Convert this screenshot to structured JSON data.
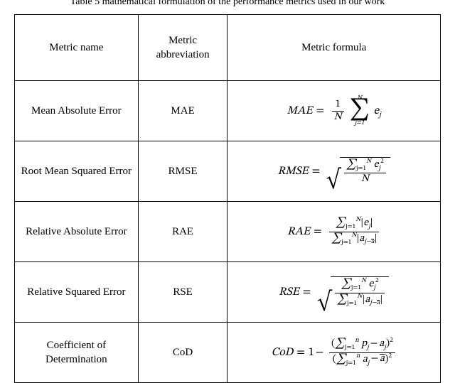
{
  "caption": "Table 5 mathematical formulation of the performance metrics used in our work",
  "headers": {
    "name": "Metric name",
    "abbr": "Metric abbreviation",
    "formula": "Metric formula"
  },
  "metrics": [
    {
      "name": "Mean Absolute Error",
      "abbr": "MAE",
      "formula_id": "mae",
      "formula_tex": "MAE = \\frac{1}{N} \\sum_{j=1}^{N} e_j"
    },
    {
      "name": "Root Mean Squared Error",
      "abbr": "RMSE",
      "formula_id": "rmse",
      "formula_tex": "RMSE = \\sqrt{ \\frac{\\sum_{j=1}^{N} e_j^{2}}{N} }"
    },
    {
      "name": "Relative Absolute Error",
      "abbr": "RAE",
      "formula_id": "rae",
      "formula_tex": "RAE = \\frac{\\sum_{j=1}^{N} |e_j|}{\\sum_{j=1}^{N} |a_{j} - \\bar a|}"
    },
    {
      "name": "Relative Squared Error",
      "abbr": "RSE",
      "formula_id": "rse",
      "formula_tex": "RSE = \\sqrt{ \\frac{\\sum_{j=1}^{N} e_j^{2}}{\\sum_{j=1}^{N} |a_{j} - \\bar a|} }"
    },
    {
      "name": "Coefficient of Determination",
      "abbr": "CoD",
      "formula_id": "cod",
      "formula_tex": "CoD = 1 - \\frac{(\\sum_{j=1}^{n} p_j - a_j)^2}{(\\sum_{j=1}^{n} a_j - \\bar a)^2}"
    }
  ]
}
